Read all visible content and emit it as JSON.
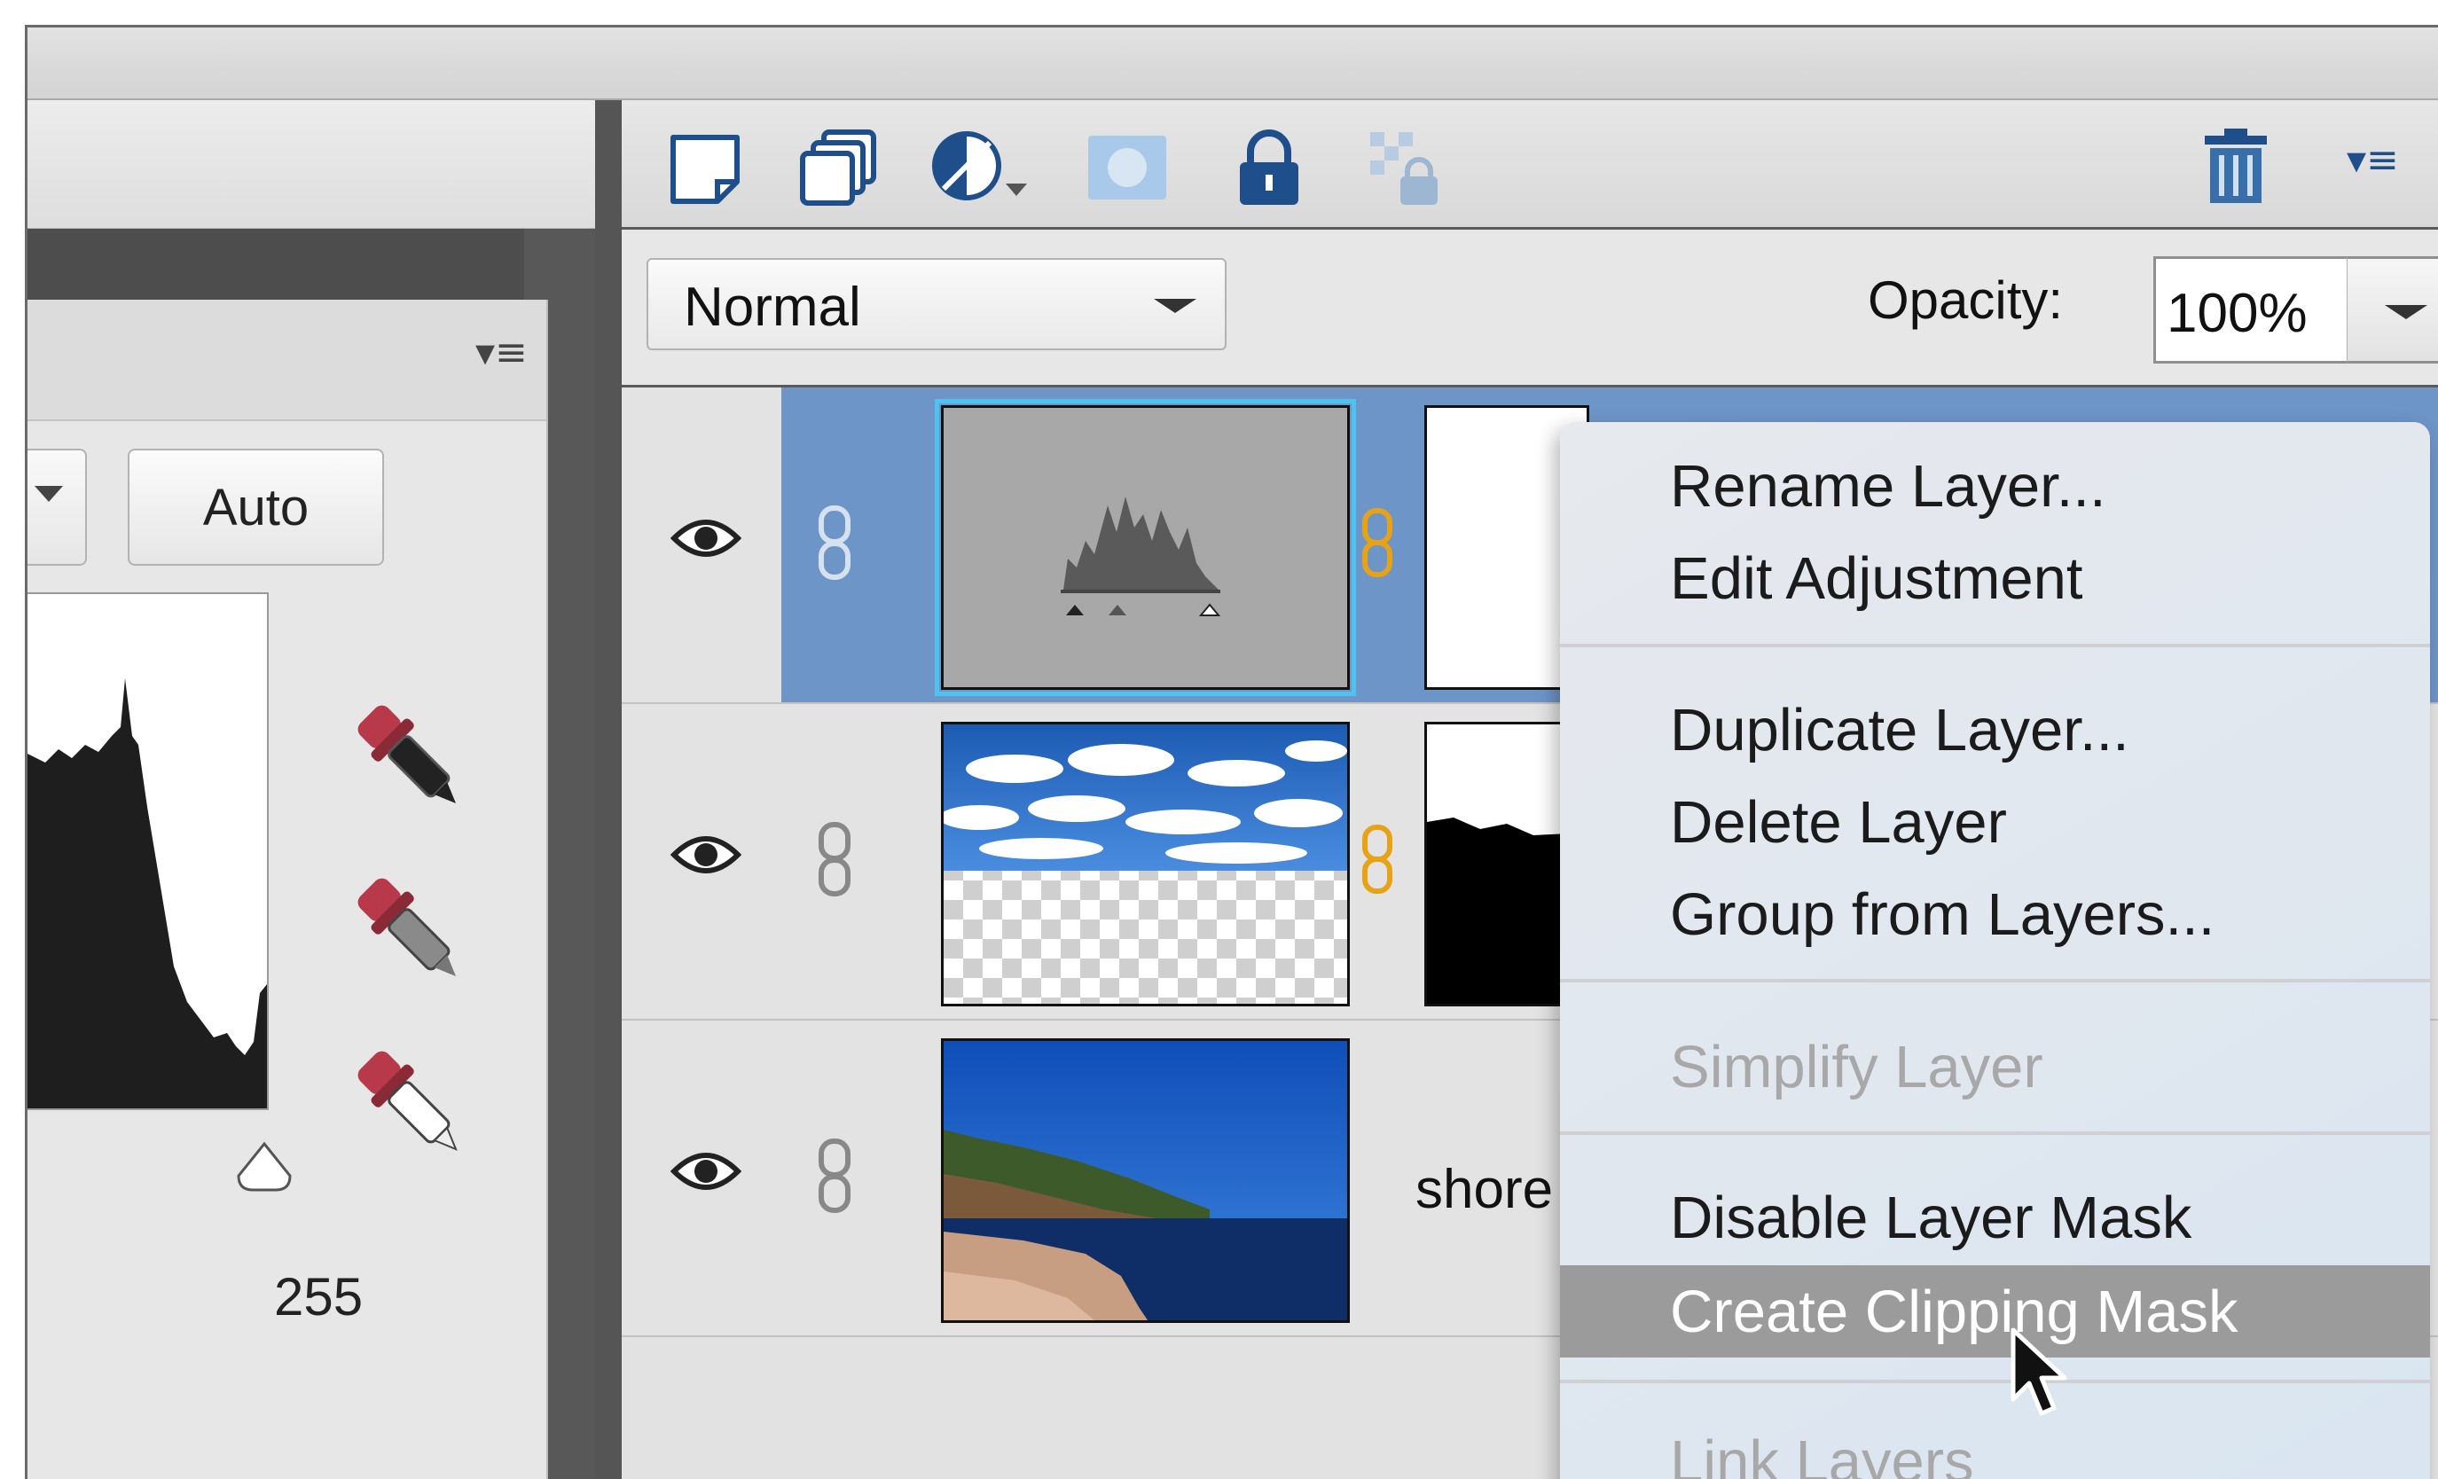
{
  "levels_panel": {
    "auto_label": "Auto",
    "max_value": "255"
  },
  "layers_panel": {
    "blend_mode": "Normal",
    "opacity_label": "Opacity:",
    "opacity_value": "100%",
    "layers": [
      {
        "name": "",
        "type": "levels-adjustment",
        "selected": true
      },
      {
        "name": "",
        "type": "sky-clouds",
        "selected": false
      },
      {
        "name": "shore",
        "type": "shoreline-photo",
        "selected": false
      }
    ]
  },
  "context_menu": {
    "items": [
      {
        "label": "Rename Layer...",
        "enabled": true
      },
      {
        "label": "Edit Adjustment",
        "enabled": true
      },
      {
        "label": "Duplicate Layer...",
        "enabled": true
      },
      {
        "label": "Delete Layer",
        "enabled": true
      },
      {
        "label": "Group from Layers...",
        "enabled": true
      },
      {
        "label": "Simplify Layer",
        "enabled": false
      },
      {
        "label": "Disable Layer Mask",
        "enabled": true
      },
      {
        "label": "Create Clipping Mask",
        "enabled": true,
        "highlighted": true
      },
      {
        "label": "Link Layers",
        "enabled": false
      }
    ]
  },
  "colors": {
    "selection_blue": "#6e95c8",
    "thumb_highlight": "#4fc3f0",
    "chain_orange": "#e6a317",
    "menu_highlight": "#9b9b9b"
  }
}
